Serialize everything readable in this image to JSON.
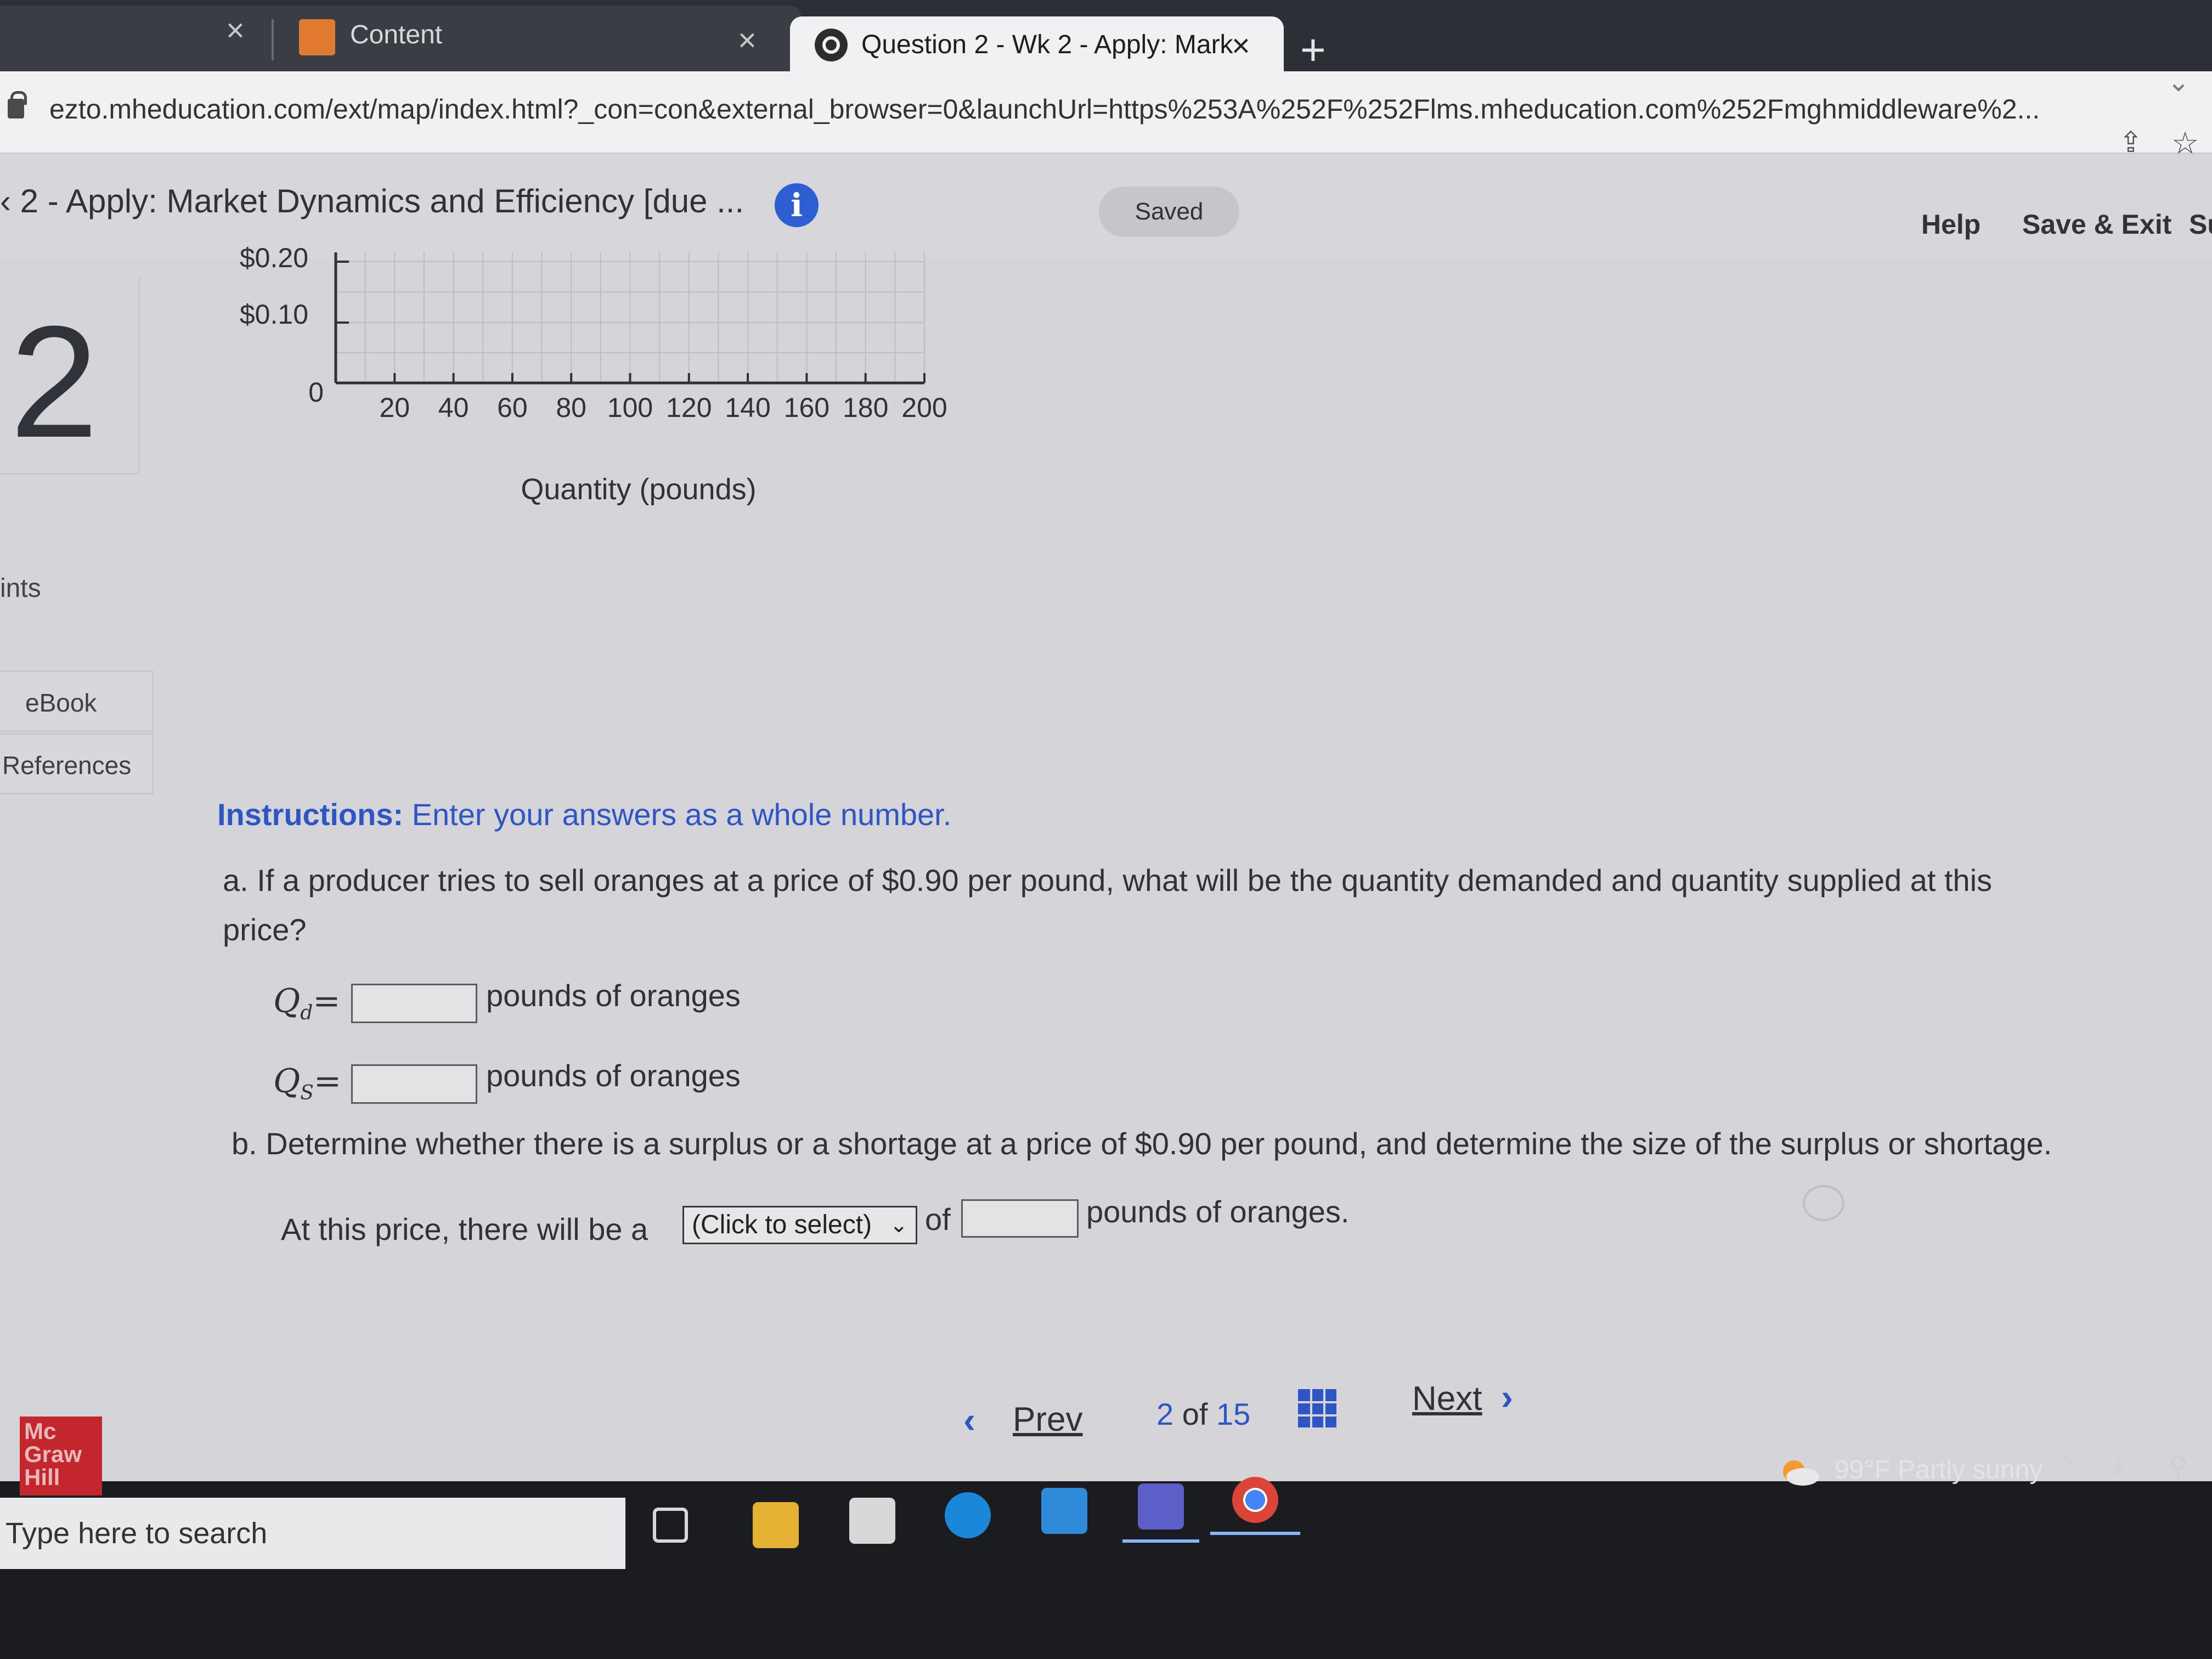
{
  "browser": {
    "tabs": [
      {
        "label": "Content"
      },
      {
        "label": "Question 2 - Wk 2 - Apply: Mark"
      }
    ],
    "url": "ezto.mheducation.com/ext/map/index.html?_con=con&external_browser=0&launchUrl=https%253A%252F%252Flms.mheducation.com%252Fmghmiddleware%2..."
  },
  "header": {
    "assignment_title": "‹ 2 - Apply: Market Dynamics and Efficiency [due ...",
    "saved_label": "Saved",
    "help_label": "Help",
    "save_exit_label": "Save & Exit",
    "submit_label_partial": "Su"
  },
  "sidebar": {
    "question_number": "2",
    "points_label": "ints",
    "ebook_label": "eBook",
    "references_label": "References"
  },
  "chart_data": {
    "type": "line",
    "xlabel": "Quantity (pounds)",
    "x_ticks": [
      "20",
      "40",
      "60",
      "80",
      "100",
      "120",
      "140",
      "160",
      "180",
      "200"
    ],
    "y_ticks": [
      "$0.20",
      "$0.10"
    ],
    "origin_label": "0",
    "xlim": [
      0,
      200
    ],
    "grid": true
  },
  "question": {
    "instructions_label": "Instructions:",
    "instructions_text": "Enter your answers as a whole number.",
    "part_a_line1": "a. If a producer tries to sell oranges at a price of $0.90 per pound, what will be the quantity demanded and quantity supplied at this",
    "part_a_line2": "price?",
    "qd_label": "Q",
    "qd_sub": "d",
    "qs_label": "Q",
    "qs_sub": "S",
    "equals": "=",
    "qd_value": "",
    "qs_value": "",
    "unit_oranges": "pounds of oranges",
    "part_b": "b. Determine whether there is a surplus or a shortage at a price of $0.90 per pound, and determine the size of the surplus or shortage.",
    "part_b_prefix": "At this price, there will be a",
    "part_b_select": "(Click to select)",
    "part_b_of": "of",
    "part_b_value": "",
    "part_b_suffix": "pounds of oranges."
  },
  "navigation": {
    "prev_label": "Prev",
    "current": "2",
    "of": "of",
    "total": "15",
    "next_label": "Next"
  },
  "branding": {
    "logo_lines": [
      "Mc",
      "Graw",
      "Hill"
    ]
  },
  "taskbar": {
    "search_placeholder": "Type here to search",
    "weather": "99°F  Partly sunny"
  }
}
